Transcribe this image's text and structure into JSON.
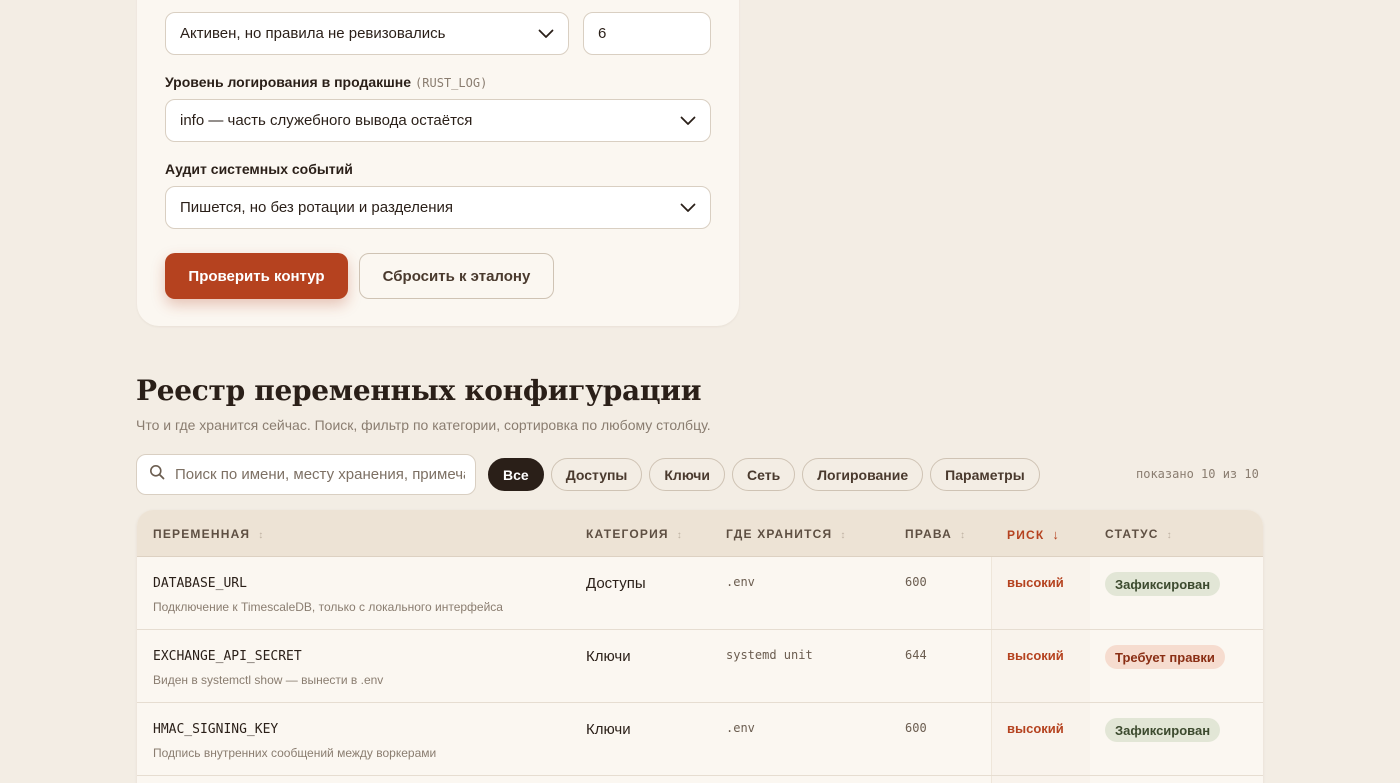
{
  "form": {
    "select1_value": "Активен, но правила не ревизовались",
    "input1_value": "6",
    "log_level_label": "Уровень логирования в продакшне",
    "log_level_hint": "(RUST_LOG)",
    "log_level_value": "info — часть служебного вывода остаётся",
    "audit_label": "Аудит системных событий",
    "audit_value": "Пишется, но без ротации и разделения",
    "check_button": "Проверить контур",
    "reset_button": "Сбросить к эталону"
  },
  "registry": {
    "title": "Реестр переменных конфигурации",
    "subtitle": "Что и где хранится сейчас. Поиск, фильтр по категории, сортировка по любому столбцу.",
    "search_placeholder": "Поиск по имени, месту хранения, примечанию",
    "filters": [
      "Все",
      "Доступы",
      "Ключи",
      "Сеть",
      "Логирование",
      "Параметры"
    ],
    "shown_count": "показано 10 из 10"
  },
  "table": {
    "headers": {
      "variable": "ПЕРЕМЕННАЯ",
      "category": "КАТЕГОРИЯ",
      "where": "ГДЕ ХРАНИТСЯ",
      "perms": "ПРАВА",
      "risk": "РИСК",
      "status": "СТАТУС"
    },
    "rows": [
      {
        "name": "DATABASE_URL",
        "note": "Подключение к TimescaleDB, только с локального интерфейса",
        "category": "Доступы",
        "where": ".env",
        "perms": "600",
        "risk": "высокий",
        "status": "Зафиксирован"
      },
      {
        "name": "EXCHANGE_API_SECRET",
        "note": "Виден в systemctl show — вынести в .env",
        "category": "Ключи",
        "where": "systemd unit",
        "perms": "644",
        "risk": "высокий",
        "status": "Требует правки"
      },
      {
        "name": "HMAC_SIGNING_KEY",
        "note": "Подпись внутренних сообщений между воркерами",
        "category": "Ключи",
        "where": ".env",
        "perms": "600",
        "risk": "высокий",
        "status": "Зафиксирован"
      }
    ]
  },
  "colors": {
    "accent": "#b5421f",
    "background": "#f3ede4",
    "card": "#fbf7f1",
    "ok_badge": "#e2e6d6",
    "warn_badge": "#f6dccf"
  },
  "icons": {
    "search": "search-icon",
    "dropdown": "chevron-down-icon",
    "sort": "sort-icon",
    "sort_active": "arrow-down-icon"
  }
}
